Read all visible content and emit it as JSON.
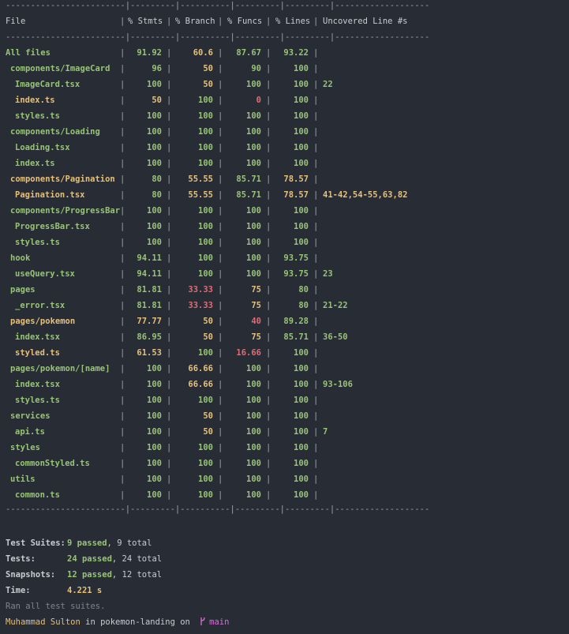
{
  "separator_line": "------------------------|---------|----------|---------|---------|-------------------",
  "headers": [
    "File",
    "% Stmts",
    "% Branch",
    "% Funcs",
    "% Lines",
    "Uncovered Line #s"
  ],
  "rows": [
    {
      "file": "All files",
      "indent": 0,
      "stmts": "91.92",
      "branch": "60.6",
      "funcs": "87.67",
      "lines": "93.22",
      "uncovered": ""
    },
    {
      "file": "components/ImageCard",
      "indent": 1,
      "stmts": "96",
      "branch": "50",
      "funcs": "90",
      "lines": "100",
      "uncovered": ""
    },
    {
      "file": "ImageCard.tsx",
      "indent": 2,
      "stmts": "100",
      "branch": "50",
      "funcs": "100",
      "lines": "100",
      "uncovered": "22"
    },
    {
      "file": "index.ts",
      "indent": 2,
      "stmts": "50",
      "branch": "100",
      "funcs": "0",
      "lines": "100",
      "uncovered": ""
    },
    {
      "file": "styles.ts",
      "indent": 2,
      "stmts": "100",
      "branch": "100",
      "funcs": "100",
      "lines": "100",
      "uncovered": ""
    },
    {
      "file": "components/Loading",
      "indent": 1,
      "stmts": "100",
      "branch": "100",
      "funcs": "100",
      "lines": "100",
      "uncovered": ""
    },
    {
      "file": "Loading.tsx",
      "indent": 2,
      "stmts": "100",
      "branch": "100",
      "funcs": "100",
      "lines": "100",
      "uncovered": ""
    },
    {
      "file": "index.ts",
      "indent": 2,
      "stmts": "100",
      "branch": "100",
      "funcs": "100",
      "lines": "100",
      "uncovered": ""
    },
    {
      "file": "components/Pagination",
      "indent": 1,
      "stmts": "80",
      "branch": "55.55",
      "funcs": "85.71",
      "lines": "78.57",
      "uncovered": ""
    },
    {
      "file": "Pagination.tsx",
      "indent": 2,
      "stmts": "80",
      "branch": "55.55",
      "funcs": "85.71",
      "lines": "78.57",
      "uncovered": "41-42,54-55,63,82"
    },
    {
      "file": "components/ProgressBar",
      "indent": 1,
      "stmts": "100",
      "branch": "100",
      "funcs": "100",
      "lines": "100",
      "uncovered": ""
    },
    {
      "file": "ProgressBar.tsx",
      "indent": 2,
      "stmts": "100",
      "branch": "100",
      "funcs": "100",
      "lines": "100",
      "uncovered": ""
    },
    {
      "file": "styles.ts",
      "indent": 2,
      "stmts": "100",
      "branch": "100",
      "funcs": "100",
      "lines": "100",
      "uncovered": ""
    },
    {
      "file": "hook",
      "indent": 1,
      "stmts": "94.11",
      "branch": "100",
      "funcs": "100",
      "lines": "93.75",
      "uncovered": ""
    },
    {
      "file": "useQuery.tsx",
      "indent": 2,
      "stmts": "94.11",
      "branch": "100",
      "funcs": "100",
      "lines": "93.75",
      "uncovered": "23"
    },
    {
      "file": "pages",
      "indent": 1,
      "stmts": "81.81",
      "branch": "33.33",
      "funcs": "75",
      "lines": "80",
      "uncovered": ""
    },
    {
      "file": "_error.tsx",
      "indent": 2,
      "stmts": "81.81",
      "branch": "33.33",
      "funcs": "75",
      "lines": "80",
      "uncovered": "21-22"
    },
    {
      "file": "pages/pokemon",
      "indent": 1,
      "stmts": "77.77",
      "branch": "50",
      "funcs": "40",
      "lines": "89.28",
      "uncovered": ""
    },
    {
      "file": "index.tsx",
      "indent": 2,
      "stmts": "86.95",
      "branch": "50",
      "funcs": "75",
      "lines": "85.71",
      "uncovered": "36-50"
    },
    {
      "file": "styled.ts",
      "indent": 2,
      "stmts": "61.53",
      "branch": "100",
      "funcs": "16.66",
      "lines": "100",
      "uncovered": ""
    },
    {
      "file": "pages/pokemon/[name]",
      "indent": 1,
      "stmts": "100",
      "branch": "66.66",
      "funcs": "100",
      "lines": "100",
      "uncovered": ""
    },
    {
      "file": "index.tsx",
      "indent": 2,
      "stmts": "100",
      "branch": "66.66",
      "funcs": "100",
      "lines": "100",
      "uncovered": "93-106"
    },
    {
      "file": "styles.ts",
      "indent": 2,
      "stmts": "100",
      "branch": "100",
      "funcs": "100",
      "lines": "100",
      "uncovered": ""
    },
    {
      "file": "services",
      "indent": 1,
      "stmts": "100",
      "branch": "50",
      "funcs": "100",
      "lines": "100",
      "uncovered": ""
    },
    {
      "file": "api.ts",
      "indent": 2,
      "stmts": "100",
      "branch": "50",
      "funcs": "100",
      "lines": "100",
      "uncovered": "7"
    },
    {
      "file": "styles",
      "indent": 1,
      "stmts": "100",
      "branch": "100",
      "funcs": "100",
      "lines": "100",
      "uncovered": ""
    },
    {
      "file": "commonStyled.ts",
      "indent": 2,
      "stmts": "100",
      "branch": "100",
      "funcs": "100",
      "lines": "100",
      "uncovered": ""
    },
    {
      "file": "utils",
      "indent": 1,
      "stmts": "100",
      "branch": "100",
      "funcs": "100",
      "lines": "100",
      "uncovered": ""
    },
    {
      "file": "common.ts",
      "indent": 2,
      "stmts": "100",
      "branch": "100",
      "funcs": "100",
      "lines": "100",
      "uncovered": ""
    }
  ],
  "summary": {
    "suites_label": "Test Suites:",
    "suites_passed": "9 passed",
    "suites_total": ", 9 total",
    "tests_label": "Tests:",
    "tests_passed": "24 passed",
    "tests_total": ", 24 total",
    "snapshots_label": "Snapshots:",
    "snapshots_passed": "12 passed",
    "snapshots_total": ", 12 total",
    "time_label": "Time:",
    "time_value": "4.221 s",
    "ran_text": "Ran all test suites."
  },
  "prompt": {
    "user": "Muhammad Sulton",
    "in": " in ",
    "dir": "pokemon-landing",
    "on": " on ",
    "branch_icon": "git-branch-icon",
    "branch": "main"
  },
  "colors": {
    "background": "#282c34",
    "high": "#98c379",
    "medium": "#e5c07b",
    "low": "#e06c75",
    "text": "#c4c8cf"
  }
}
